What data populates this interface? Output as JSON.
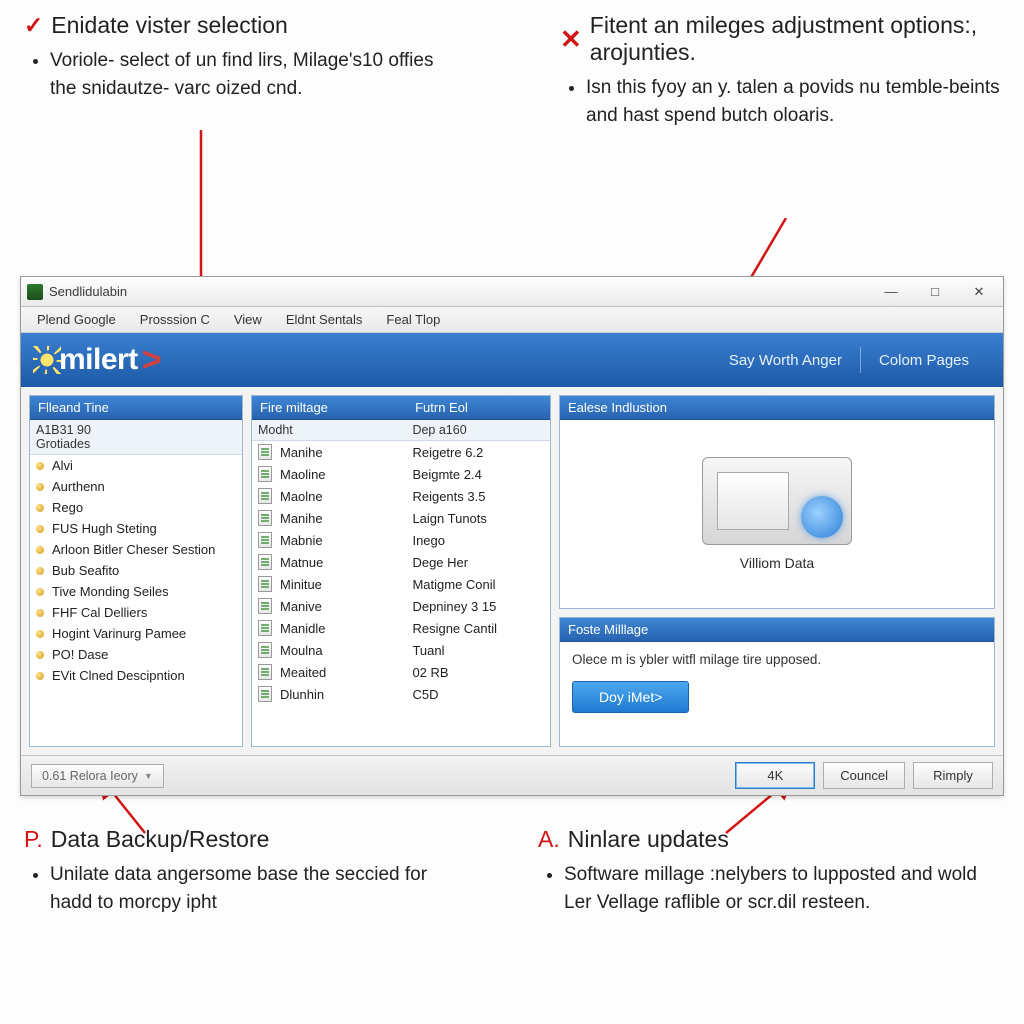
{
  "callouts": {
    "tl": {
      "mark": "✓",
      "title": "Enidate vister selection",
      "bullets": [
        "Voriole- select of un find lirs, Milage's10 offies the snidautze- varc oized cnd."
      ]
    },
    "tr": {
      "mark": "✕",
      "title": "Fitent an mileges adjustment options:, arojunties.",
      "bullets": [
        "Isn this fyoy an y. talen a povids nu temble-beints and hast spend butch oloaris."
      ]
    },
    "bl": {
      "mark": "P.",
      "title": "Data Backup/Restore",
      "bullets": [
        "Unilate data angersome base the seccied for hadd to morcpy ipht"
      ]
    },
    "br": {
      "mark": "A.",
      "title": "Ninlare updates",
      "bullets": [
        "Software millage :nelybers to lupposted and wold Ler Vellage raflible or scr.dil resteen."
      ]
    }
  },
  "window": {
    "title": "Sendlidulabin",
    "controls": {
      "min": "—",
      "max": "□",
      "close": "✕"
    }
  },
  "menubar": [
    "Plend Google",
    "Prosssion C",
    "View",
    "Eldnt Sentals",
    "Feal Tlop"
  ],
  "header": {
    "logo_text": "milert",
    "links": [
      "Say Worth Anger",
      "Colom Pages"
    ]
  },
  "panels": {
    "left": {
      "title": "Flleand Tine",
      "subhead_row": "A1B31 90 Grotiades",
      "items": [
        "Alvi",
        "Aurthenn",
        "Rego",
        "FUS Hugh Steting",
        "Arloon Bitler Cheser Sestion",
        "Bub Seafito",
        "Tive Monding Seiles",
        "FHF Cal Delliers",
        "Hogint Varinurg Pamee",
        "PO! Dase",
        "EVit Clned Descipntion"
      ]
    },
    "mid": {
      "title_a": "Fire miltage",
      "title_b": "Futrn Eol",
      "subhead_a": "Modht",
      "subhead_b": "Dep a160",
      "rows": [
        {
          "a": "Manihe",
          "b": "Reigetre 6.2"
        },
        {
          "a": "Maoline",
          "b": "Beigmte 2.4"
        },
        {
          "a": "Maolne",
          "b": "Reigents 3.5"
        },
        {
          "a": "Manihe",
          "b": "Laign Tunots"
        },
        {
          "a": "Mabnie",
          "b": "Inego"
        },
        {
          "a": "Matnue",
          "b": "Dege Her"
        },
        {
          "a": "Minitue",
          "b": "Matigme Conil"
        },
        {
          "a": "Manive",
          "b": "Depniney 3 15"
        },
        {
          "a": "Manidle",
          "b": "Resigne Cantil"
        },
        {
          "a": "Moulna",
          "b": "Tuanl"
        },
        {
          "a": "Meaited",
          "b": "02 RB"
        },
        {
          "a": "Dlunhin",
          "b": "C5D"
        }
      ]
    },
    "right": {
      "device_title": "Ealese Indlustion",
      "device_caption": "Villiom Data",
      "foste_title": "Foste Milllage",
      "foste_msg": "Olece m is ybler witfl milage tire upposed.",
      "foste_button": "Doy iMet>"
    }
  },
  "bottombar": {
    "restore": "0.61 Relora Ieory",
    "ok": "4K",
    "cancel": "Councel",
    "apply": "Rimply"
  }
}
